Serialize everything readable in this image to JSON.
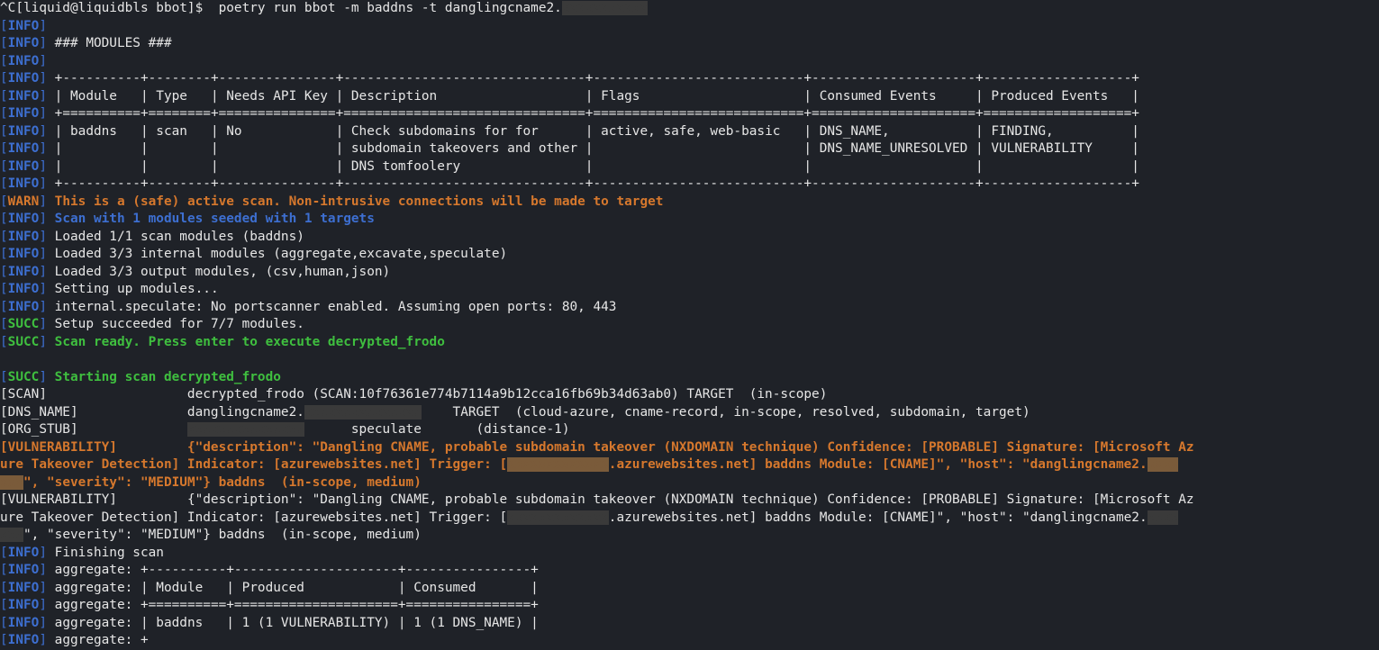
{
  "prompt": {
    "prefix": "^C[liquid@liquidbls bbot]$ ",
    "command": " poetry run bbot -m baddns -t danglingcname2."
  },
  "tag": {
    "info": "INFO",
    "warn": "WARN",
    "succ": "SUCC"
  },
  "modules_header": " ### MODULES ###",
  "table": {
    "border_top": " +----------+--------+---------------+-------------------------------+---------------------------+---------------------+-------------------+",
    "header": " | Module   | Type   | Needs API Key | Description                   | Flags                     | Consumed Events     | Produced Events   |",
    "border_sep": " +==========+========+===============+===============================+===========================+=====================+===================+",
    "row1": " | baddns   | scan   | No            | Check subdomains for for      | active, safe, web-basic   | DNS_NAME,           | FINDING,          |",
    "row2": " |          |        |               | subdomain takeovers and other |                           | DNS_NAME_UNRESOLVED | VULNERABILITY     |",
    "row3": " |          |        |               | DNS tomfoolery                |                           |                     |                   |",
    "border_bot": " +----------+--------+---------------+-------------------------------+---------------------------+---------------------+-------------------+"
  },
  "lines": {
    "warn_scan": " This is a (safe) active scan. Non-intrusive connections will be made to target",
    "scan_seed": " Scan with 1 modules seeded with 1 targets",
    "loaded1": " Loaded 1/1 scan modules (baddns)",
    "loaded2": " Loaded 3/3 internal modules (aggregate,excavate,speculate)",
    "loaded3": " Loaded 3/3 output modules, (csv,human,json)",
    "setup": " Setting up modules...",
    "speculate": " internal.speculate: No portscanner enabled. Assuming open ports: 80, 443",
    "succ_setup": " Setup succeeded for 7/7 modules.",
    "succ_ready": " Scan ready. Press enter to execute decrypted_frodo",
    "succ_start": " Starting scan decrypted_frodo"
  },
  "events": {
    "scan": "[SCAN]                  decrypted_frodo (SCAN:10f76361e774b7114a9b12cca16fb69b34d63ab0) TARGET  (in-scope)",
    "dns_pre": "[DNS_NAME]              danglingcname2.",
    "dns_post": "    TARGET  (cloud-azure, cname-record, in-scope, resolved, subdomain, target)",
    "org_pre": "[ORG_STUB]              ",
    "org_mid": "      speculate       (distance-1)"
  },
  "vuln": {
    "tag": "[VULNERABILITY]",
    "part1": "         {\"description\": \"Dangling CNAME, probable subdomain takeover (NXDOMAIN technique) Confidence: [PROBABLE] Signature: [Microsoft Az",
    "part2a": "ure Takeover Detection] Indicator: [azurewebsites.net] Trigger: [",
    "part2b": ".azurewebsites.net] baddns Module: [CNAME]\", \"host\": \"danglingcname2.",
    "part3a": "\", \"severity\": \"MEDIUM\"} baddns  (in-scope, medium)"
  },
  "footer": {
    "finishing": " Finishing scan",
    "agg_border": " aggregate: +----------+---------------------+----------------+",
    "agg_header": " aggregate: | Module   | Produced            | Consumed       |",
    "agg_sep": " aggregate: +==========+=====================+================+",
    "agg_row": " aggregate: | baddns   | 1 (1 VULNERABILITY) | 1 (1 DNS_NAME) |",
    "agg_partial": " aggregate: +"
  }
}
